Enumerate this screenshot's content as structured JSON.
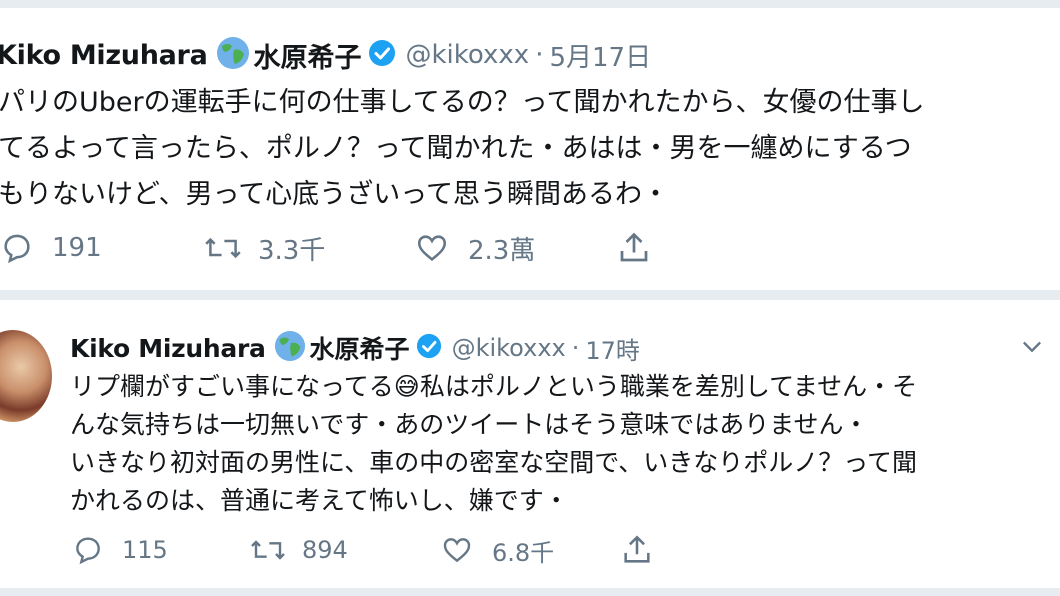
{
  "tweets": [
    {
      "name": "Kiko Mizuhara",
      "jname": "水原希子",
      "handle": "@kikoxxx",
      "separator": "·",
      "time": "5月17日",
      "text": "パリのUberの運転手に何の仕事してるの？って聞かれたから、女優の仕事し\nてるよって言ったら、ポルノ？って聞かれた・あはは・男を一纏めにするつ\nもりないけど、男って心底うざいって思う瞬間あるわ・",
      "actions": {
        "reply": "191",
        "retweet": "3.3千",
        "like": "2.3萬"
      }
    },
    {
      "name": "Kiko Mizuhara",
      "jname": "水原希子",
      "handle": "@kikoxxx",
      "separator": "·",
      "time": "17時",
      "text_part1": "リプ欄がすごい事になってる",
      "text_emoji": "😅",
      "text_part2": "私はポルノという職業を差別してません・そ\nんな気持ちは一切無いです・あのツイートはそう意味ではありません・\nいきなり初対面の男性に、車の中の密室な空間で、いきなりポルノ？って聞\nかれるのは、普通に考えて怖いし、嫌です・",
      "actions": {
        "reply": "115",
        "retweet": "894",
        "like": "6.8千"
      }
    }
  ],
  "colors": {
    "background": "#e6ecf0",
    "card": "#ffffff",
    "text": "#14171a",
    "muted": "#657786",
    "verified": "#1da1f2",
    "globe_land": "#4caf50",
    "globe_water": "#6fb1e8"
  },
  "icons": [
    "globe-icon",
    "verified-badge-icon",
    "reply-icon",
    "retweet-icon",
    "like-icon",
    "share-icon",
    "chevron-down-icon"
  ]
}
